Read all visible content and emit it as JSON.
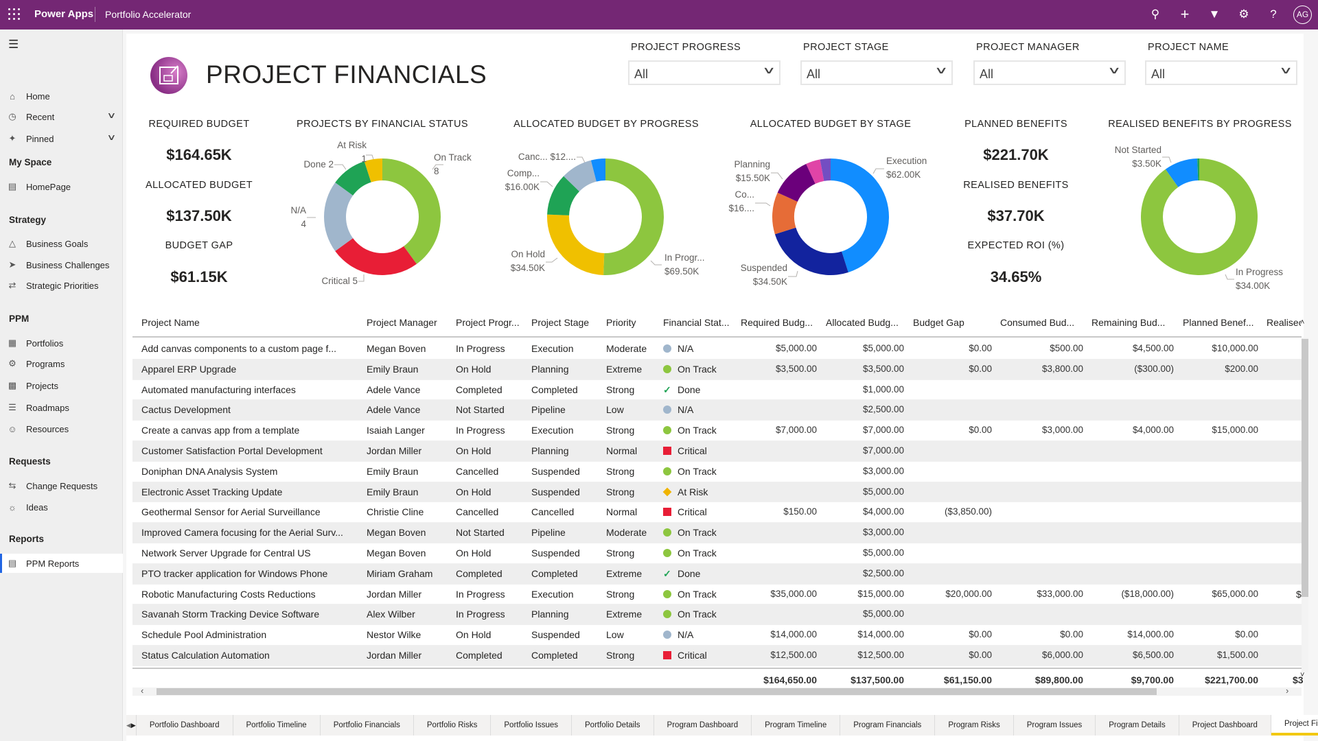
{
  "topbar": {
    "app_name": "Power Apps",
    "environment": "Portfolio Accelerator",
    "avatar_initials": "AG",
    "color": "#742774",
    "icons": [
      "search-icon",
      "plus-icon",
      "filter-icon",
      "gear-icon",
      "help-icon"
    ]
  },
  "sidebar": {
    "items": [
      {
        "label": "Home",
        "icon": "home-icon",
        "type": "item"
      },
      {
        "label": "Recent",
        "icon": "clock-icon",
        "type": "item",
        "expandable": true
      },
      {
        "label": "Pinned",
        "icon": "pin-icon",
        "type": "item",
        "expandable": true
      },
      {
        "label": "My Space",
        "type": "header"
      },
      {
        "label": "HomePage",
        "icon": "clipboard-icon",
        "type": "item"
      },
      {
        "label": "Strategy",
        "type": "header"
      },
      {
        "label": "Business Goals",
        "icon": "mountain-flag-icon",
        "type": "item"
      },
      {
        "label": "Business Challenges",
        "icon": "rocket-icon",
        "type": "item"
      },
      {
        "label": "Strategic Priorities",
        "icon": "arrows-icon",
        "type": "item"
      },
      {
        "label": "PPM",
        "type": "header"
      },
      {
        "label": "Portfolios",
        "icon": "folder-icon",
        "type": "item"
      },
      {
        "label": "Programs",
        "icon": "gear-icon",
        "type": "item"
      },
      {
        "label": "Projects",
        "icon": "board-icon",
        "type": "item"
      },
      {
        "label": "Roadmaps",
        "icon": "roadmap-icon",
        "type": "item"
      },
      {
        "label": "Resources",
        "icon": "person-icon",
        "type": "item"
      },
      {
        "label": "Requests",
        "type": "header"
      },
      {
        "label": "Change Requests",
        "icon": "swap-icon",
        "type": "item"
      },
      {
        "label": "Ideas",
        "icon": "lightbulb-icon",
        "type": "item"
      },
      {
        "label": "Reports",
        "type": "header"
      },
      {
        "label": "PPM Reports",
        "icon": "report-icon",
        "type": "item",
        "selected": true
      }
    ]
  },
  "page": {
    "title": "PROJECT FINANCIALS"
  },
  "filters": [
    {
      "label": "PROJECT PROGRESS",
      "value": "All"
    },
    {
      "label": "PROJECT STAGE",
      "value": "All"
    },
    {
      "label": "PROJECT MANAGER",
      "value": "All"
    },
    {
      "label": "PROJECT NAME",
      "value": "All"
    }
  ],
  "kpis": [
    {
      "label": "REQUIRED BUDGET",
      "value": "$164.65K"
    },
    {
      "label": "ALLOCATED BUDGET",
      "value": "$137.50K"
    },
    {
      "label": "BUDGET GAP",
      "value": "$61.15K"
    },
    {
      "label": "PLANNED BENEFITS",
      "value": "$221.70K"
    },
    {
      "label": "REALISED BENEFITS",
      "value": "$37.70K"
    },
    {
      "label": "EXPECTED ROI (%)",
      "value": "34.65%"
    }
  ],
  "chart_data": [
    {
      "type": "pie",
      "donut": true,
      "title": "PROJECTS BY FINANCIAL STATUS",
      "slices": [
        {
          "label": "On Track",
          "value_text": "8",
          "value": 8,
          "color": "#8dc63f"
        },
        {
          "label": "Critical",
          "value_text": "5",
          "value": 5,
          "color": "#e81e36"
        },
        {
          "label": "N/A",
          "value_text": "4",
          "value": 4,
          "color": "#a0b6cc"
        },
        {
          "label": "Done",
          "value_text": "2",
          "value": 2,
          "color": "#1fa355"
        },
        {
          "label": "At Risk",
          "value_text": "1",
          "value": 1,
          "color": "#f0c000"
        }
      ]
    },
    {
      "type": "pie",
      "donut": true,
      "title": "ALLOCATED BUDGET BY PROGRESS",
      "slices": [
        {
          "label": "In Progr...",
          "value_text": "$69.50K",
          "value": 69.5,
          "color": "#8dc63f"
        },
        {
          "label": "On Hold",
          "value_text": "$34.50K",
          "value": 34.5,
          "color": "#f0c000"
        },
        {
          "label": "Comp...",
          "value_text": "$16.00K",
          "value": 16.0,
          "color": "#1fa355"
        },
        {
          "label": "Canc...",
          "value_text": "$12....",
          "value": 12.0,
          "color": "#a0b6cc"
        },
        {
          "value": 5.5,
          "color": "#118dff"
        }
      ]
    },
    {
      "type": "pie",
      "donut": true,
      "title": "ALLOCATED BUDGET BY STAGE",
      "slices": [
        {
          "label": "Execution",
          "value_text": "$62.00K",
          "value": 62.0,
          "color": "#118dff"
        },
        {
          "label": "Suspended",
          "value_text": "$34.50K",
          "value": 34.5,
          "color": "#12239e"
        },
        {
          "label": "Co...",
          "value_text": "$16....",
          "value": 16.0,
          "color": "#e66c37"
        },
        {
          "label": "Planning",
          "value_text": "$15.50K",
          "value": 15.5,
          "color": "#6b007b"
        },
        {
          "value": 5.5,
          "color": "#e044a7"
        },
        {
          "value": 4.0,
          "color": "#744ec2"
        }
      ]
    },
    {
      "type": "pie",
      "donut": true,
      "title": "REALISED BENEFITS BY PROGRESS",
      "slices": [
        {
          "label": "In Progress",
          "value_text": "$34.00K",
          "value": 34.0,
          "color": "#8dc63f"
        },
        {
          "label": "Not Started",
          "value_text": "$3.50K",
          "value": 3.5,
          "color": "#118dff"
        },
        {
          "value": 0.2,
          "color": "#1fa355"
        }
      ]
    }
  ],
  "table": {
    "columns": [
      "Project Name",
      "Project Manager",
      "Project Progr...",
      "Project Stage",
      "Priority",
      "Financial Stat...",
      "Required Budg...",
      "Allocated Budg...",
      "Budget Gap",
      "Consumed Bud...",
      "Remaining Bud...",
      "Planned Benef...",
      "Realisec"
    ],
    "status_styles": {
      "N/A": {
        "icon": "circle-icon",
        "color": "#a0b6cc"
      },
      "On Track": {
        "icon": "circle-icon",
        "color": "#8dc63f"
      },
      "Done": {
        "icon": "check-icon",
        "color": "#1fa355"
      },
      "Critical": {
        "icon": "square-icon",
        "color": "#e81e36"
      },
      "At Risk": {
        "icon": "diamond-icon",
        "color": "#f0b400"
      }
    },
    "rows": [
      [
        "Add canvas components to a custom page f...",
        "Megan Boven",
        "In Progress",
        "Execution",
        "Moderate",
        "N/A",
        "$5,000.00",
        "$5,000.00",
        "$0.00",
        "$500.00",
        "$4,500.00",
        "$10,000.00",
        ""
      ],
      [
        "Apparel ERP Upgrade",
        "Emily Braun",
        "On Hold",
        "Planning",
        "Extreme",
        "On Track",
        "$3,500.00",
        "$3,500.00",
        "$0.00",
        "$3,800.00",
        "($300.00)",
        "$200.00",
        ""
      ],
      [
        "Automated manufacturing interfaces",
        "Adele Vance",
        "Completed",
        "Completed",
        "Strong",
        "Done",
        "",
        "$1,000.00",
        "",
        "",
        "",
        "",
        ""
      ],
      [
        "Cactus Development",
        "Adele Vance",
        "Not Started",
        "Pipeline",
        "Low",
        "N/A",
        "",
        "$2,500.00",
        "",
        "",
        "",
        "",
        ""
      ],
      [
        "Create a canvas app from a template",
        "Isaiah Langer",
        "In Progress",
        "Execution",
        "Strong",
        "On Track",
        "$7,000.00",
        "$7,000.00",
        "$0.00",
        "$3,000.00",
        "$4,000.00",
        "$15,000.00",
        ""
      ],
      [
        "Customer Satisfaction Portal Development",
        "Jordan Miller",
        "On Hold",
        "Planning",
        "Normal",
        "Critical",
        "",
        "$7,000.00",
        "",
        "",
        "",
        "",
        ""
      ],
      [
        "Doniphan DNA Analysis System",
        "Emily Braun",
        "Cancelled",
        "Suspended",
        "Strong",
        "On Track",
        "",
        "$3,000.00",
        "",
        "",
        "",
        "",
        ""
      ],
      [
        "Electronic Asset Tracking Update",
        "Emily Braun",
        "On Hold",
        "Suspended",
        "Strong",
        "At Risk",
        "",
        "$5,000.00",
        "",
        "",
        "",
        "",
        ""
      ],
      [
        "Geothermal Sensor for Aerial Surveillance",
        "Christie Cline",
        "Cancelled",
        "Cancelled",
        "Normal",
        "Critical",
        "$150.00",
        "$4,000.00",
        "($3,850.00)",
        "",
        "",
        "",
        ""
      ],
      [
        "Improved Camera focusing for the Aerial Surv...",
        "Megan Boven",
        "Not Started",
        "Pipeline",
        "Moderate",
        "On Track",
        "",
        "$3,000.00",
        "",
        "",
        "",
        "",
        ""
      ],
      [
        "Network Server Upgrade for Central US",
        "Megan Boven",
        "On Hold",
        "Suspended",
        "Strong",
        "On Track",
        "",
        "$5,000.00",
        "",
        "",
        "",
        "",
        ""
      ],
      [
        "PTO tracker application for Windows Phone",
        "Miriam Graham",
        "Completed",
        "Completed",
        "Extreme",
        "Done",
        "",
        "$2,500.00",
        "",
        "",
        "",
        "",
        ""
      ],
      [
        "Robotic Manufacturing Costs Reductions",
        "Jordan Miller",
        "In Progress",
        "Execution",
        "Strong",
        "On Track",
        "$35,000.00",
        "$15,000.00",
        "$20,000.00",
        "$33,000.00",
        "($18,000.00)",
        "$65,000.00",
        "$"
      ],
      [
        "Savanah Storm Tracking Device Software",
        "Alex Wilber",
        "In Progress",
        "Planning",
        "Extreme",
        "On Track",
        "",
        "$5,000.00",
        "",
        "",
        "",
        "",
        ""
      ],
      [
        "Schedule Pool Administration",
        "Nestor Wilke",
        "On Hold",
        "Suspended",
        "Low",
        "N/A",
        "$14,000.00",
        "$14,000.00",
        "$0.00",
        "$0.00",
        "$14,000.00",
        "$0.00",
        ""
      ],
      [
        "Status Calculation Automation",
        "Jordan Miller",
        "Completed",
        "Completed",
        "Strong",
        "Critical",
        "$12,500.00",
        "$12,500.00",
        "$0.00",
        "$6,000.00",
        "$6,500.00",
        "$1,500.00",
        ""
      ]
    ],
    "totals": [
      "$164,650.00",
      "$137,500.00",
      "$61,150.00",
      "$89,800.00",
      "$9,700.00",
      "$221,700.00",
      "$3"
    ]
  },
  "tabs": [
    "Portfolio Dashboard",
    "Portfolio Timeline",
    "Portfolio Financials",
    "Portfolio Risks",
    "Portfolio Issues",
    "Portfolio Details",
    "Program Dashboard",
    "Program Timeline",
    "Program Financials",
    "Program Risks",
    "Program Issues",
    "Program Details",
    "Project Dashboard",
    "Project Fi"
  ],
  "active_tab": "Project Fi"
}
